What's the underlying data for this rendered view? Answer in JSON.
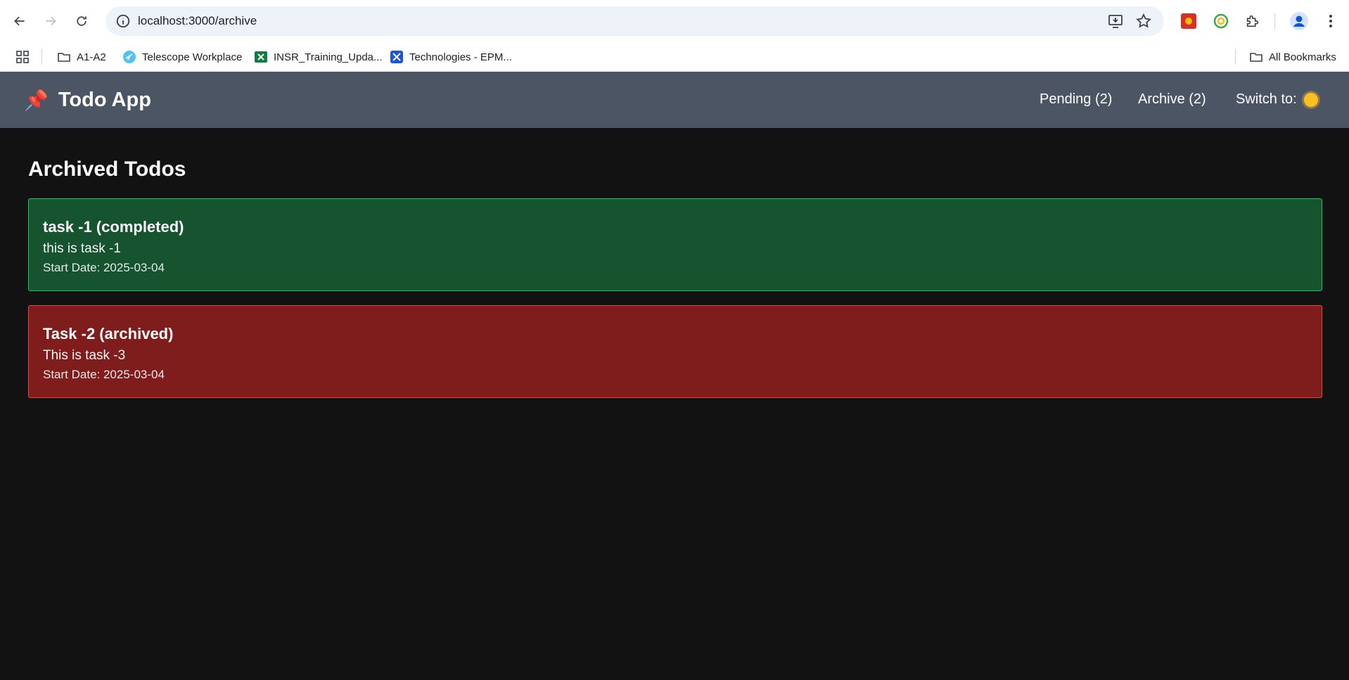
{
  "browser": {
    "url": "localhost:3000/archive",
    "bookmarks": [
      {
        "label": "A1-A2",
        "icon": "folder-icon"
      },
      {
        "label": "Telescope Workplace",
        "icon": "telescope-icon"
      },
      {
        "label": "INSR_Training_Upda...",
        "icon": "excel-icon"
      },
      {
        "label": "Technologies - EPM...",
        "icon": "epm-icon"
      }
    ],
    "all_bookmarks": "All Bookmarks"
  },
  "app": {
    "title": "Todo App",
    "brand_icon": "📌",
    "nav": {
      "pending": "Pending (2)",
      "archive": "Archive (2)",
      "switch_label": "Switch to:"
    }
  },
  "page": {
    "title": "Archived Todos",
    "todos": [
      {
        "title": "task -1 (completed)",
        "description": "this is task -1",
        "start_date": "Start Date: 2025-03-04",
        "status": "completed",
        "color": "#165430"
      },
      {
        "title": "Task -2 (archived)",
        "description": "This is task -3",
        "start_date": "Start Date: 2025-03-04",
        "status": "archived",
        "color": "#7f1d1d"
      }
    ]
  }
}
